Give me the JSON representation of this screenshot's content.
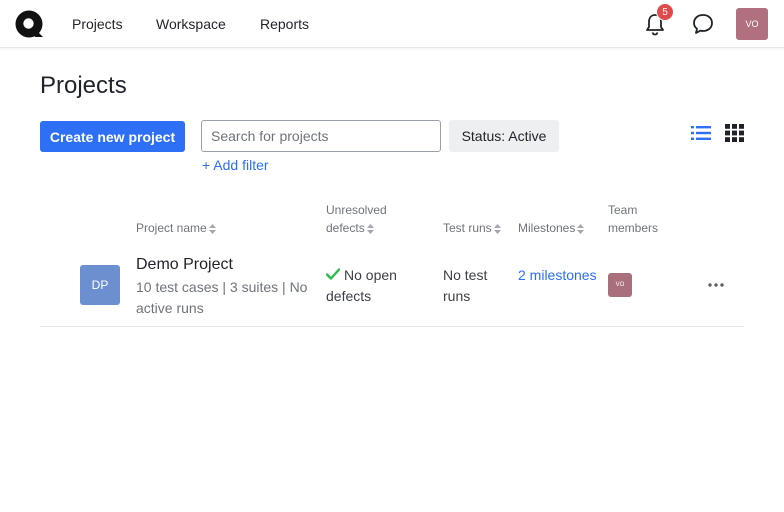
{
  "nav": {
    "items": [
      "Projects",
      "Workspace",
      "Reports"
    ],
    "notifications_count": "5",
    "user_initials": "VO"
  },
  "page": {
    "title": "Projects",
    "create_button": "Create new project",
    "search_placeholder": "Search for projects",
    "status_filter": "Status: Active",
    "add_filter": "+ Add filter"
  },
  "table": {
    "headers": {
      "project_name": "Project name",
      "unresolved_line1": "Unresolved",
      "unresolved_line2": "defects",
      "test_runs": "Test runs",
      "milestones": "Milestones",
      "team_line1": "Team",
      "team_line2": "members"
    },
    "rows": [
      {
        "avatar": "DP",
        "name": "Demo Project",
        "meta": "10 test cases | 3 suites | No active runs",
        "defects": "No open defects",
        "runs": "No test runs",
        "milestones": "2 milestones",
        "member_initials": "VO"
      }
    ]
  },
  "colors": {
    "accent": "#2d6ff5",
    "badge": "#e04a4a",
    "success": "#2dbb4d"
  }
}
